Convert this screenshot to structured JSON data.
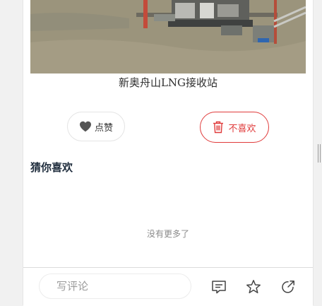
{
  "article": {
    "image_caption": "新奥舟山LNG接收站"
  },
  "actions": {
    "like_label": "点赞",
    "dislike_label": "不喜欢"
  },
  "recommend": {
    "title": "猜你喜欢",
    "end_text": "没有更多了"
  },
  "footer": {
    "comment_placeholder": "写评论"
  },
  "icons": {
    "like": "heart-icon",
    "dislike": "trash-icon",
    "comment": "comment-icon",
    "favorite": "star-icon",
    "share": "share-icon"
  },
  "colors": {
    "accent_red": "#e03b3b",
    "title_dark": "#1f2d3d",
    "muted_text": "#8a8a8a"
  }
}
